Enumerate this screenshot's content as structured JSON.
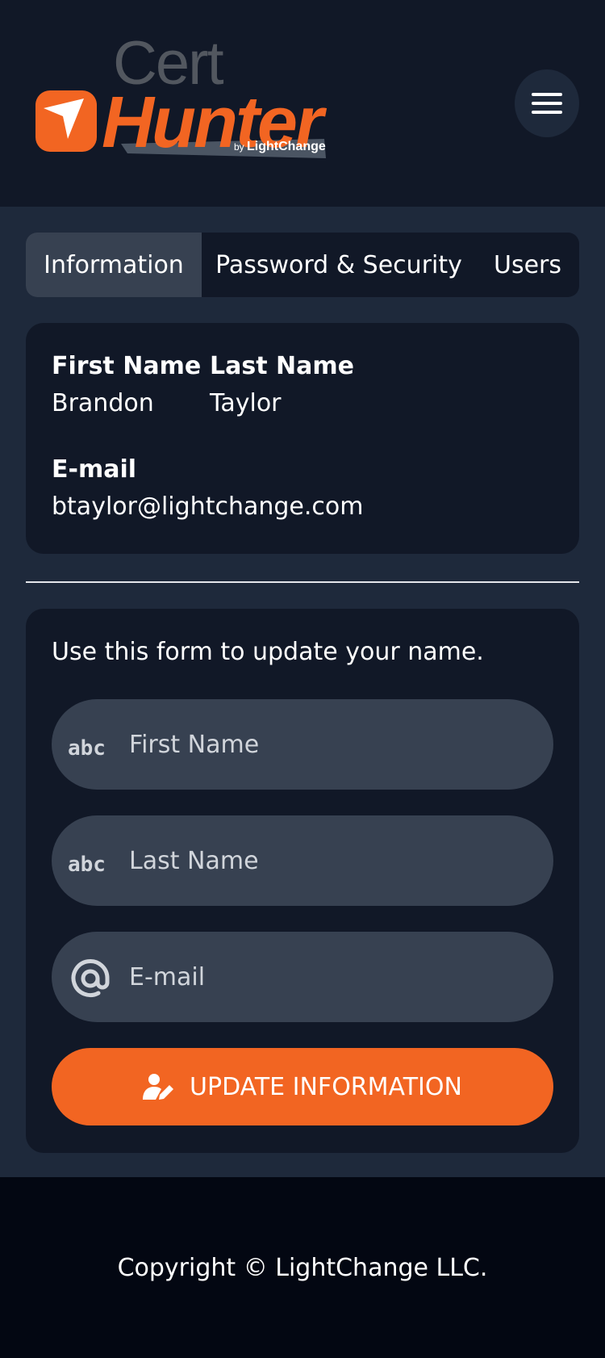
{
  "brand": {
    "logo_top": "Cert",
    "logo_main": "Hunter",
    "logo_by": "by",
    "logo_company": "LightChange",
    "accent_color": "#f26522",
    "menu_icon": "hamburger-icon"
  },
  "tabs": [
    {
      "label": "Information",
      "active": true
    },
    {
      "label": "Password & Security",
      "active": false
    },
    {
      "label": "Users",
      "active": false
    }
  ],
  "info": {
    "first_name_label": "First Name",
    "first_name_value": "Brandon",
    "last_name_label": "Last Name",
    "last_name_value": "Taylor",
    "email_label": "E-mail",
    "email_value": "btaylor@lightchange.com"
  },
  "form": {
    "intro": "Use this form to update your name.",
    "first_name_placeholder": "First Name",
    "first_name_icon": "abc-icon",
    "last_name_placeholder": "Last Name",
    "last_name_icon": "abc-icon",
    "email_placeholder": "E-mail",
    "email_icon": "at-icon",
    "submit_label": "UPDATE INFORMATION",
    "submit_icon": "user-edit-icon"
  },
  "footer": {
    "copyright": "Copyright © LightChange LLC."
  }
}
